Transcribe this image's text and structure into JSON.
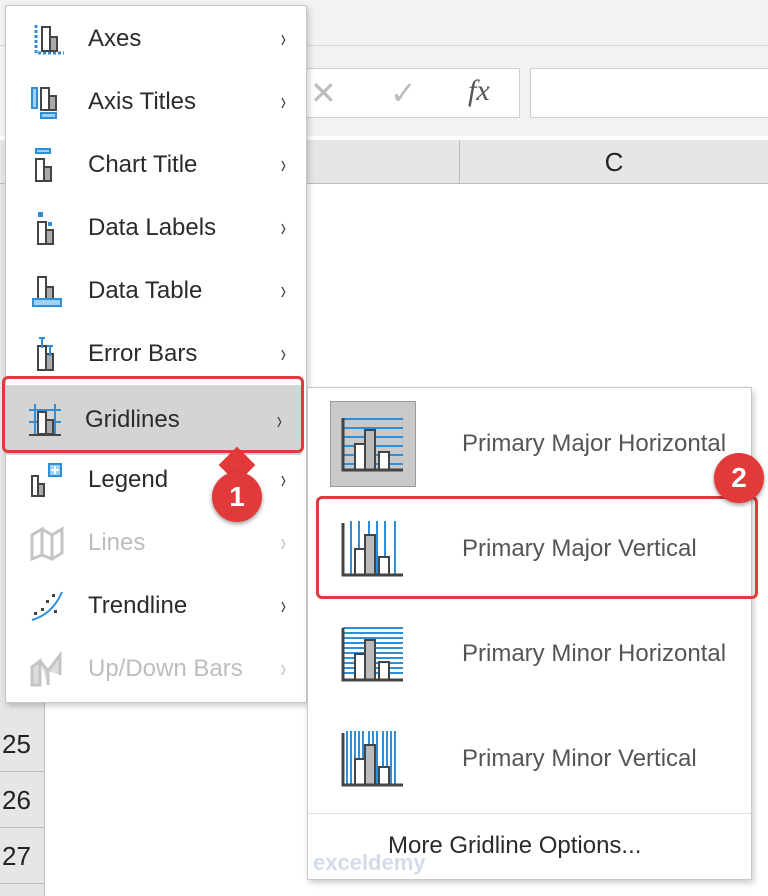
{
  "formula_bar": {
    "cancel_icon": "✕",
    "enter_icon": "✓",
    "fx_label": "fx",
    "name_box_value": ""
  },
  "columns": [
    "C"
  ],
  "rows": [
    "25",
    "26",
    "27"
  ],
  "menu": {
    "items": [
      {
        "label": "Axes",
        "icon": "axes-icon",
        "enabled": true
      },
      {
        "label": "Axis Titles",
        "icon": "axis-titles-icon",
        "enabled": true
      },
      {
        "label": "Chart Title",
        "icon": "chart-title-icon",
        "enabled": true
      },
      {
        "label": "Data Labels",
        "icon": "data-labels-icon",
        "enabled": true
      },
      {
        "label": "Data Table",
        "icon": "data-table-icon",
        "enabled": true
      },
      {
        "label": "Error Bars",
        "icon": "error-bars-icon",
        "enabled": true
      },
      {
        "label": "Gridlines",
        "icon": "gridlines-icon",
        "enabled": true,
        "selected": true
      },
      {
        "label": "Legend",
        "icon": "legend-icon",
        "enabled": true
      },
      {
        "label": "Lines",
        "icon": "lines-icon",
        "enabled": false
      },
      {
        "label": "Trendline",
        "icon": "trendline-icon",
        "enabled": true
      },
      {
        "label": "Up/Down Bars",
        "icon": "updown-bars-icon",
        "enabled": false
      }
    ],
    "arrow": "›"
  },
  "submenu": {
    "items": [
      {
        "label": "Primary Major Horizontal",
        "checked": true
      },
      {
        "label": "Primary Major Vertical"
      },
      {
        "label": "Primary Minor Horizontal"
      },
      {
        "label": "Primary Minor Vertical"
      }
    ],
    "more_label": "More Gridline Options..."
  },
  "badges": {
    "step1": "1",
    "step2": "2"
  },
  "watermark": "exceldemy",
  "colors": {
    "accent": "#2e8fd8",
    "highlight": "#e23a3a"
  }
}
